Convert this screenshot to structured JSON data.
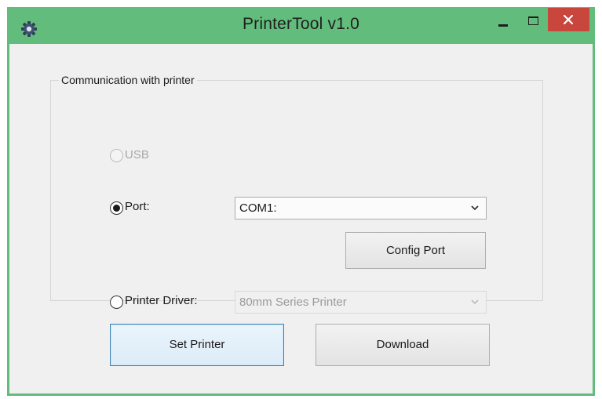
{
  "window": {
    "title": "PrinterTool v1.0",
    "title_bar_color": "#62bd7c",
    "close_button_color": "#c9463d",
    "icons": {
      "app": "gear-icon",
      "minimize": "minimize-icon",
      "maximize": "maximize-icon",
      "close": "close-icon"
    }
  },
  "communication": {
    "group_label": "Communication with printer",
    "options": {
      "usb": {
        "label": "USB",
        "selected": false,
        "enabled": false
      },
      "port": {
        "label": "Port:",
        "selected": true,
        "enabled": true
      },
      "printer_driver": {
        "label": "Printer Driver:",
        "selected": false,
        "enabled": true
      }
    },
    "port_select": {
      "value": "COM1:",
      "enabled": true
    },
    "config_port_button": "Config Port",
    "driver_select": {
      "value": "80mm Series Printer",
      "enabled": false
    }
  },
  "actions": {
    "set_printer": "Set Printer",
    "download": "Download"
  }
}
